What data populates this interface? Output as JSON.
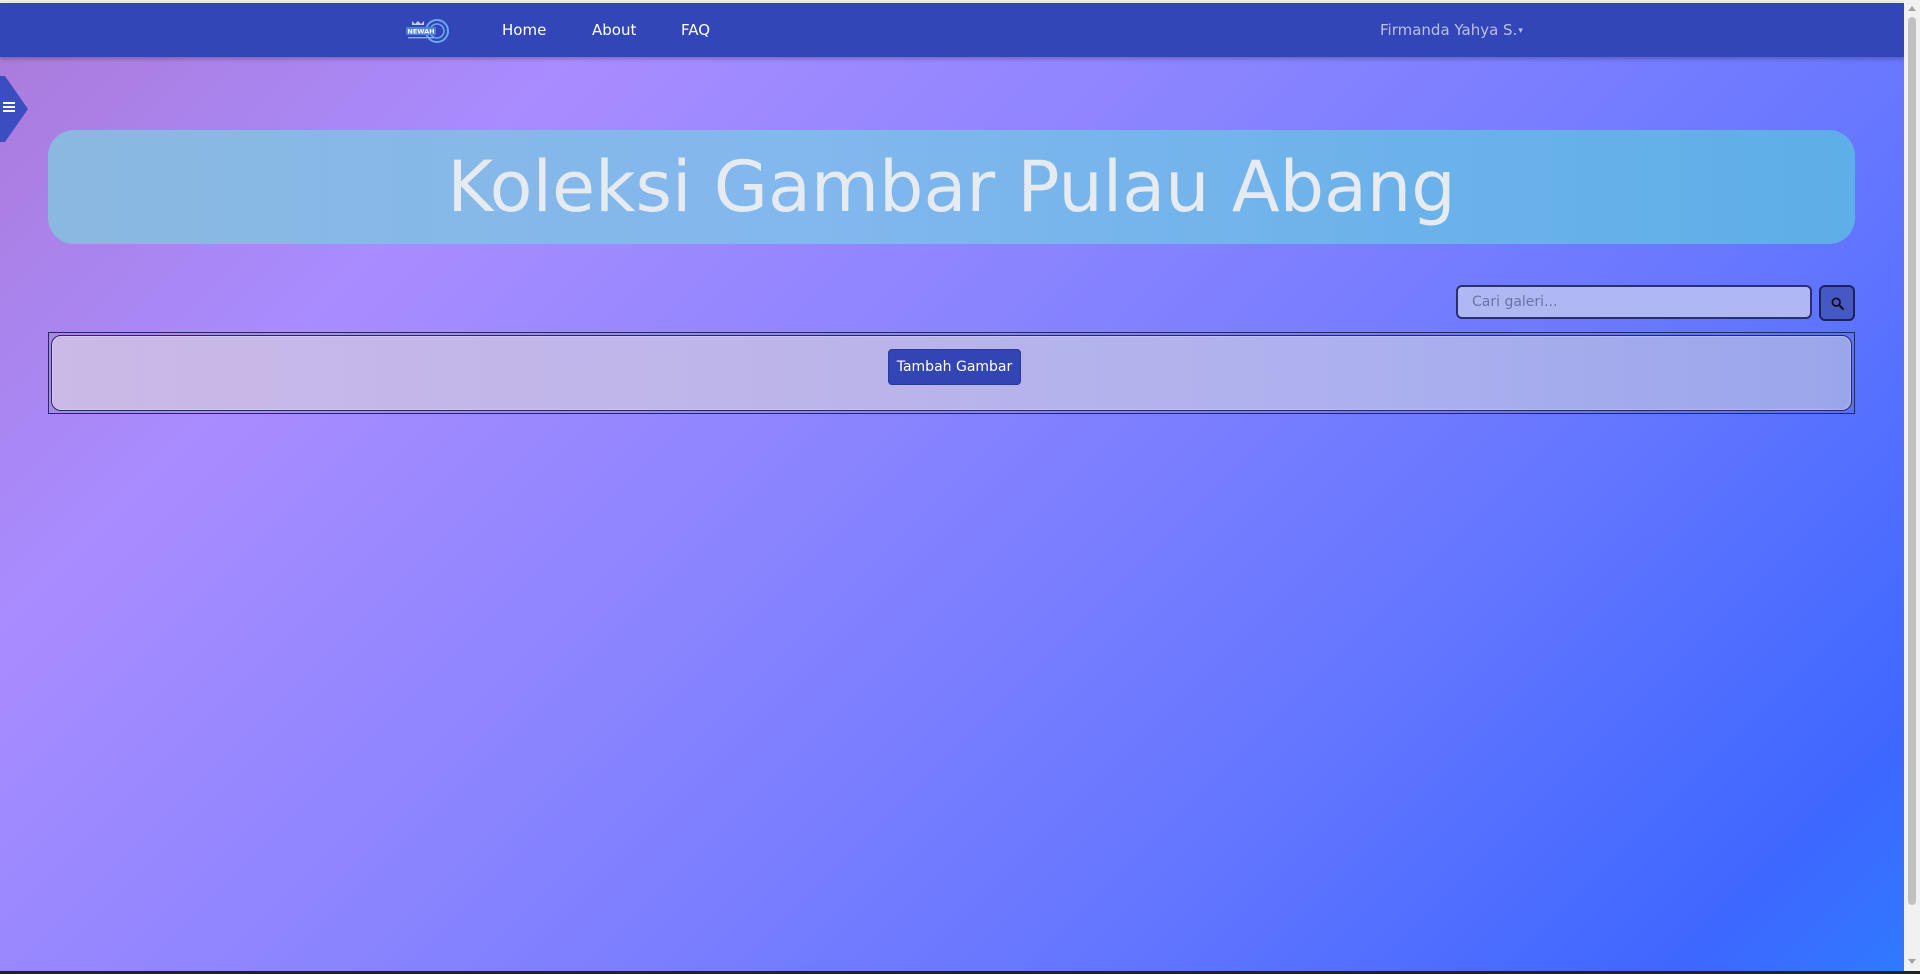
{
  "navbar": {
    "logo_text": "NEWAH",
    "links": [
      "Home",
      "About",
      "FAQ"
    ],
    "user_name": "Firmanda Yahya S."
  },
  "sidebar_toggle": {
    "icon": "hamburger-menu-icon"
  },
  "hero": {
    "title": "Koleksi Gambar Pulau Abang"
  },
  "search": {
    "placeholder": "Cari galeri...",
    "value": "",
    "icon": "search-icon"
  },
  "gallery": {
    "add_button_label": "Tambah Gambar"
  },
  "colors": {
    "navbar": "#3246b8",
    "hero": "#7bb6ea",
    "button": "#3344b4"
  }
}
